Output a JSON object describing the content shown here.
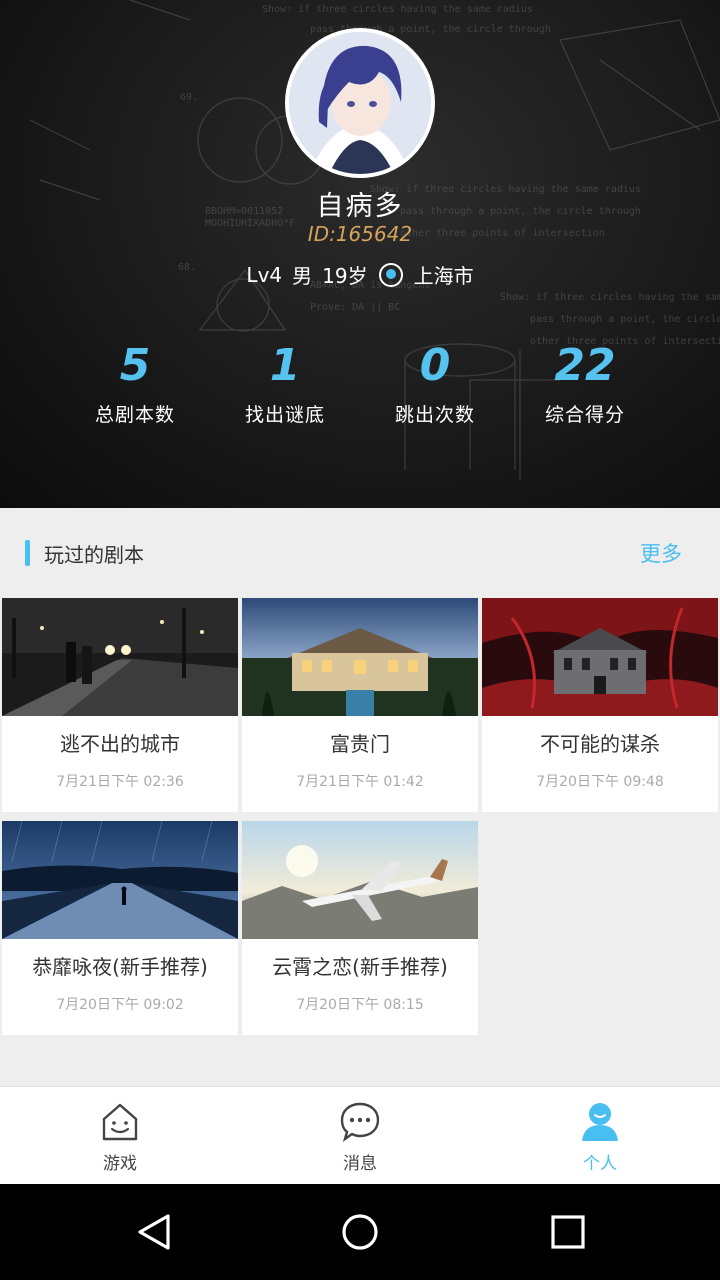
{
  "profile": {
    "name": "自病多",
    "id": "ID:165642",
    "level": "Lv4",
    "gender": "男",
    "age": "19岁",
    "location": "上海市"
  },
  "stats": [
    {
      "value": "5",
      "label": "总剧本数"
    },
    {
      "value": "1",
      "label": "找出谜底"
    },
    {
      "value": "0",
      "label": "跳出次数"
    },
    {
      "value": "22",
      "label": "综合得分"
    }
  ],
  "section": {
    "title": "玩过的剧本",
    "more": "更多"
  },
  "scripts": [
    {
      "title": "逃不出的城市",
      "date": "7月21日下午 02:36"
    },
    {
      "title": "富贵门",
      "date": "7月21日下午 01:42"
    },
    {
      "title": "不可能的谋杀",
      "date": "7月20日下午 09:48"
    },
    {
      "title": "恭靡咏夜(新手推荐)",
      "date": "7月20日下午 09:02"
    },
    {
      "title": "云霄之恋(新手推荐)",
      "date": "7月20日下午 08:15"
    }
  ],
  "tabs": [
    {
      "label": "游戏",
      "icon": "home-smile-icon"
    },
    {
      "label": "消息",
      "icon": "chat-bubble-icon"
    },
    {
      "label": "个人",
      "icon": "person-icon",
      "active": true
    }
  ],
  "colors": {
    "accent": "#48bff0",
    "id_gold": "#d6a35a",
    "header_bg": "#1a1a1a"
  }
}
